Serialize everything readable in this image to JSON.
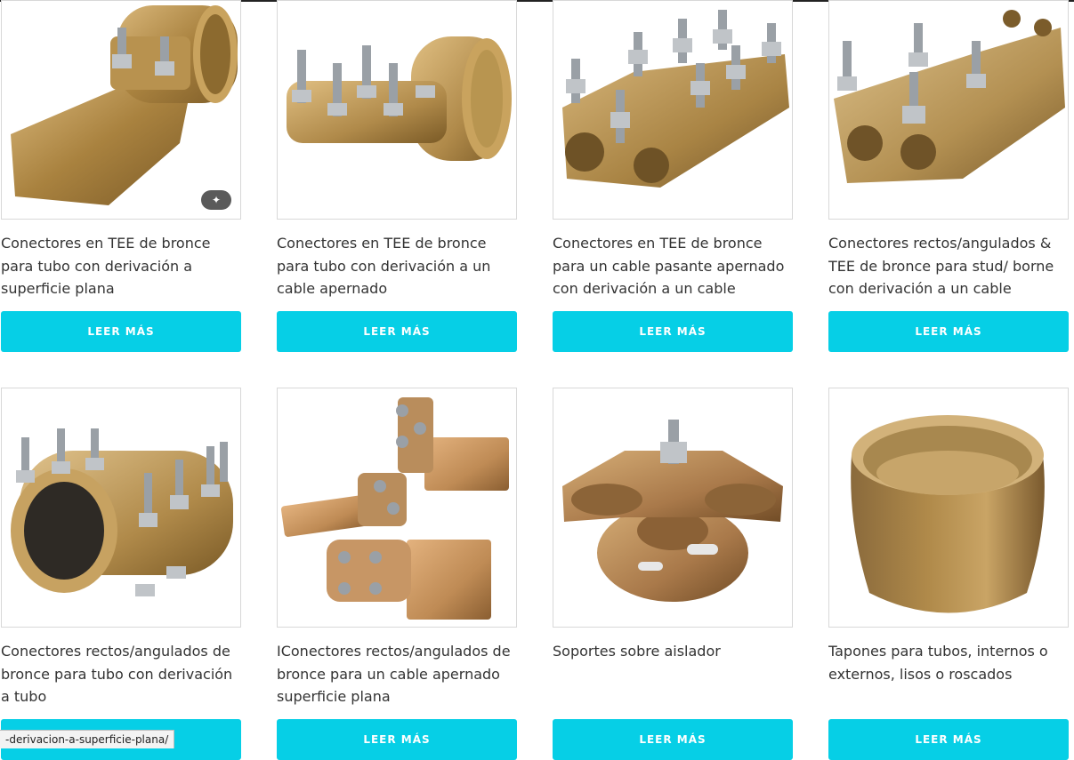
{
  "products": [
    {
      "title": "Conectores en TEE de bronce para tubo con derivación a superficie plana",
      "button": "LEER MÁS",
      "image": "bronze-pipe-clamp-flat-pad",
      "has_edit_badge": true
    },
    {
      "title": "Conectores en TEE de bronce para tubo con derivación a un cable apernado",
      "button": "LEER MÁS",
      "image": "bronze-pipe-clamp-bolted-cable"
    },
    {
      "title": "Conectores en TEE de bronce para un cable pasante apernado con derivación a un cable apernado",
      "button": "LEER MÁS",
      "image": "bronze-tee-cable-connector"
    },
    {
      "title": "Conectores rectos/angulados & TEE de bronce para stud/ borne con derivación a un cable apernado",
      "button": "LEER MÁS",
      "image": "bronze-stud-connector"
    },
    {
      "title": "Conectores rectos/angulados de bronce para tubo con derivación a tubo",
      "button": "LEER MÁS",
      "image": "bronze-pipe-to-pipe-connector"
    },
    {
      "title": "IConectores rectos/angulados de bronce para un cable apernado superficie plana",
      "button": "LEER MÁS",
      "image": "bronze-cable-flat-pads"
    },
    {
      "title": "Soportes sobre aislador",
      "button": "LEER MÁS",
      "image": "bronze-insulator-support"
    },
    {
      "title": "Tapones para tubos, internos o externos, lisos o roscados",
      "button": "LEER MÁS",
      "image": "bronze-pipe-cap"
    }
  ],
  "status_url": "-derivacion-a-superficie-plana/",
  "colors": {
    "button": "#06cfe6",
    "bronze": "#b08a4a",
    "steel": "#9aa0a6"
  }
}
